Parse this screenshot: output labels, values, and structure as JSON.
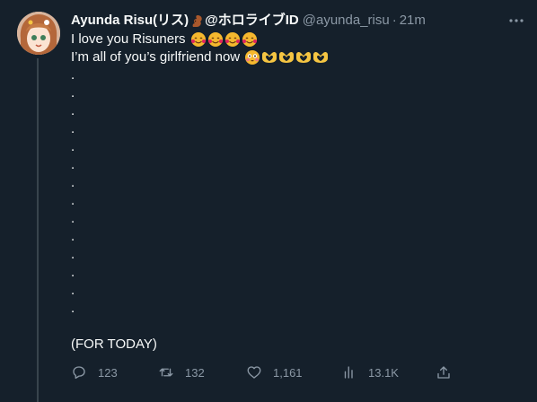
{
  "tweet": {
    "display_name": "Ayunda Risu(リス)",
    "display_name_suffix": "@ホロライブID",
    "handle": "@ayunda_risu",
    "separator": "·",
    "time": "21m",
    "lines": [
      "I love you Risuners",
      "I’m all of you’s girlfriend now",
      ".",
      ".",
      ".",
      ".",
      ".",
      ".",
      ".",
      ".",
      ".",
      ".",
      ".",
      ".",
      ".",
      ".",
      "",
      "(FOR TODAY)"
    ]
  },
  "actions": {
    "replies": "123",
    "retweets": "132",
    "likes": "1,161",
    "views": "13.1K"
  },
  "icons": {
    "more": "more-dots-icon",
    "reply": "reply-icon",
    "retweet": "retweet-icon",
    "like": "heart-icon",
    "views": "views-icon",
    "share": "share-icon"
  },
  "colors": {
    "background": "#15202b",
    "text": "#f7f9f9",
    "muted": "#8b98a5",
    "thread_line": "#38444d"
  }
}
